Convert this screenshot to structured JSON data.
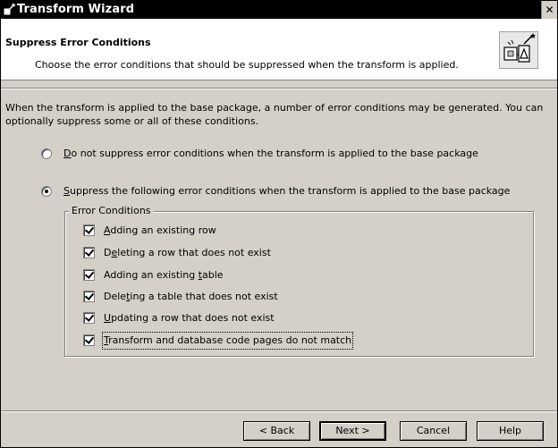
{
  "window": {
    "title": "Transform Wizard",
    "close_glyph": "✕"
  },
  "header": {
    "title": "Suppress Error Conditions",
    "subtitle": "Choose the error conditions that should be suppressed when the transform is applied.",
    "icon": "transform-wizard-icon"
  },
  "body": {
    "intro": "When the transform is applied to the base package, a number of error conditions may be generated. You can optionally suppress some or all of these conditions.",
    "options": [
      {
        "mnemonic": "D",
        "rest": "o not suppress error conditions when the transform is applied to the base package",
        "selected": false
      },
      {
        "mnemonic": "S",
        "rest": "uppress the following error conditions when the transform is applied to the base package",
        "selected": true
      }
    ],
    "group_label": "Error Conditions",
    "conditions": [
      {
        "pre": "",
        "mnemonic": "A",
        "post": "dding an existing row",
        "checked": true
      },
      {
        "pre": "D",
        "mnemonic": "e",
        "post": "leting a row that does not exist",
        "checked": true
      },
      {
        "pre": "Adding an existing ",
        "mnemonic": "t",
        "post": "able",
        "checked": true
      },
      {
        "pre": "Dele",
        "mnemonic": "t",
        "post": "ing a table that does not exist",
        "checked": true
      },
      {
        "pre": "",
        "mnemonic": "U",
        "post": "pdating a row that does not exist",
        "checked": true
      },
      {
        "pre": "",
        "mnemonic": "T",
        "post": "ransform and database code pages do not match",
        "checked": true
      }
    ]
  },
  "buttons": {
    "back": "< Back",
    "next": "Next >",
    "cancel": "Cancel",
    "help": "Help"
  }
}
